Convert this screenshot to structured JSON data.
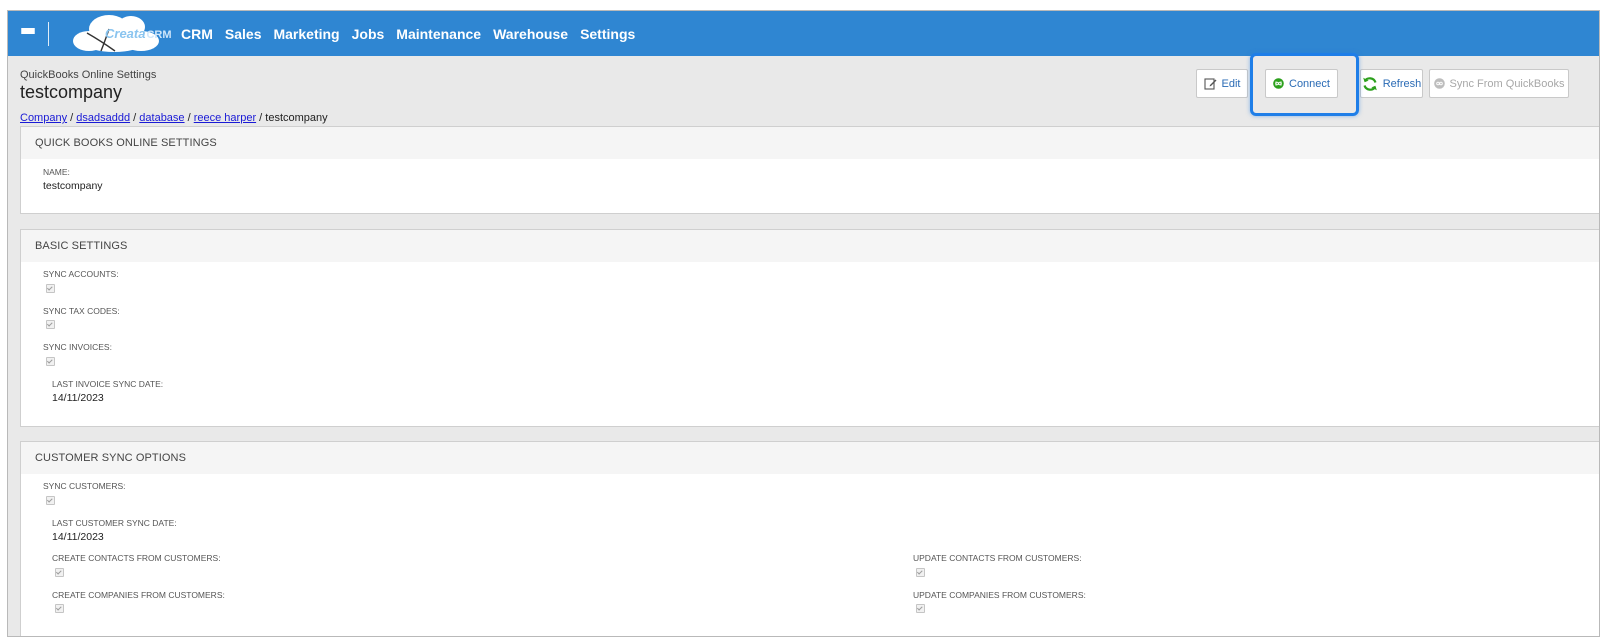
{
  "nav": {
    "logo_main": "Creata",
    "logo_suffix": "CRM",
    "items": [
      "CRM",
      "Sales",
      "Marketing",
      "Jobs",
      "Maintenance",
      "Warehouse",
      "Settings"
    ]
  },
  "page": {
    "subtitle": "QuickBooks Online Settings",
    "title": "testcompany"
  },
  "breadcrumb": {
    "links": [
      "Company",
      "dsadsaddd",
      "database",
      "reece harper"
    ],
    "current": "testcompany",
    "separator": "/"
  },
  "toolbar": {
    "edit": "Edit",
    "connect": "Connect",
    "refresh": "Refresh",
    "sync": "Sync From QuickBooks"
  },
  "sections": {
    "qbo": {
      "title": "QUICK BOOKS ONLINE SETTINGS",
      "name_label": "NAME:",
      "name_value": "testcompany"
    },
    "basic": {
      "title": "BASIC SETTINGS",
      "sync_accounts": "SYNC ACCOUNTS:",
      "sync_tax_codes": "SYNC TAX CODES:",
      "sync_invoices": "SYNC INVOICES:",
      "last_invoice_label": "LAST INVOICE SYNC DATE:",
      "last_invoice_value": "14/11/2023"
    },
    "customer": {
      "title": "CUSTOMER SYNC OPTIONS",
      "sync_customers": "SYNC CUSTOMERS:",
      "last_customer_label": "LAST CUSTOMER SYNC DATE:",
      "last_customer_value": "14/11/2023",
      "create_contacts": "CREATE CONTACTS FROM CUSTOMERS:",
      "update_contacts": "UPDATE CONTACTS FROM CUSTOMERS:",
      "create_companies": "CREATE COMPANIES FROM CUSTOMERS:",
      "update_companies": "UPDATE COMPANIES FROM CUSTOMERS:"
    }
  },
  "colors": {
    "navbar": "#2f86d2",
    "link": "#1a1ad6",
    "highlight": "#1e7ee8",
    "connect_icon": "#2ca01c",
    "refresh_icon": "#2ca01c"
  }
}
